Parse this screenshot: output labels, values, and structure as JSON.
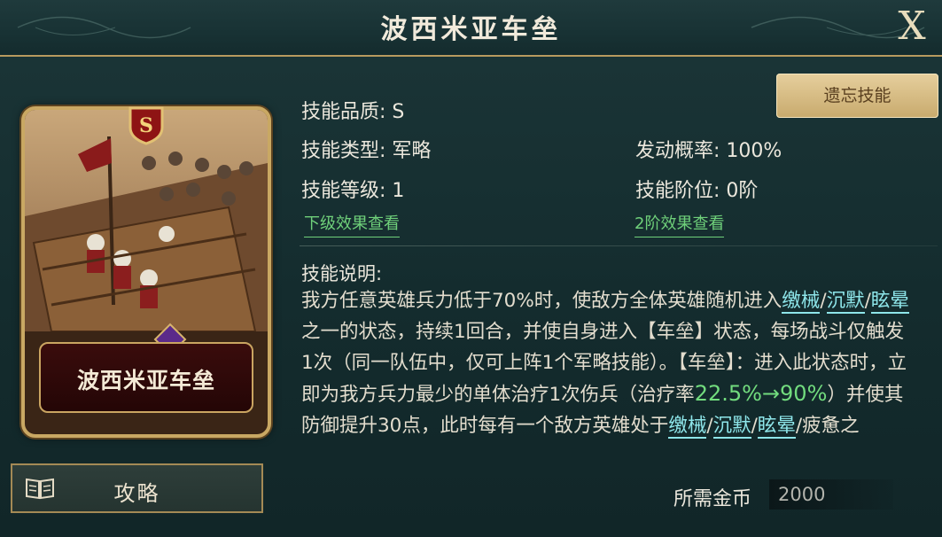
{
  "header": {
    "title": "波西米亚车垒",
    "close_label": "X"
  },
  "card": {
    "grade": "S",
    "name": "波西米亚车垒"
  },
  "strategy_button": {
    "label": "攻略"
  },
  "forget_button": {
    "label": "遗忘技能"
  },
  "info": {
    "quality": "技能品质: S",
    "type": "技能类型: 军略",
    "level": "技能等级: 1",
    "trigger_rate": "发动概率: 100%",
    "rank": "技能阶位: 0阶",
    "lower_effect_link": "下级效果查看",
    "rank2_effect_link": "2阶效果查看"
  },
  "description": {
    "title": "技能说明:",
    "segments": [
      {
        "text": "我方任意英雄兵力低于70%时，使敌方全体英雄随机进入",
        "style": "plain"
      },
      {
        "text": "缴械",
        "style": "keyword"
      },
      {
        "text": "/",
        "style": "plain"
      },
      {
        "text": "沉默",
        "style": "keyword"
      },
      {
        "text": "/",
        "style": "plain"
      },
      {
        "text": "眩晕",
        "style": "keyword"
      },
      {
        "text": "之一的状态，持续1回合，并使自身进入【车垒】状态，每场战斗仅触发1次（同一队伍中，仅可上阵1个军略技能）。【车垒】：进入此状态时，立即为我方兵力最少的单体治疗1次伤兵（治疗率",
        "style": "plain"
      },
      {
        "text": "22.5%→90%",
        "style": "number"
      },
      {
        "text": "）并使其防御提升30点，此时每有一个敌方英雄处于",
        "style": "plain"
      },
      {
        "text": "缴械",
        "style": "keyword"
      },
      {
        "text": "/",
        "style": "plain"
      },
      {
        "text": "沉默",
        "style": "keyword"
      },
      {
        "text": "/",
        "style": "plain"
      },
      {
        "text": "眩晕",
        "style": "keyword"
      },
      {
        "text": "/疲惫之",
        "style": "plain"
      }
    ]
  },
  "cost": {
    "label": "所需金币",
    "value": "2000"
  },
  "colors": {
    "background": "#132a2c",
    "gold_border": "#c9a863",
    "keyword": "#8ee6ea",
    "highlight_number": "#72dc7e",
    "link": "#6fd07a",
    "button_gold": "#d8bd85"
  },
  "icons": [
    "close-icon",
    "book-icon",
    "grade-shield-icon",
    "purple-gem-icon"
  ]
}
